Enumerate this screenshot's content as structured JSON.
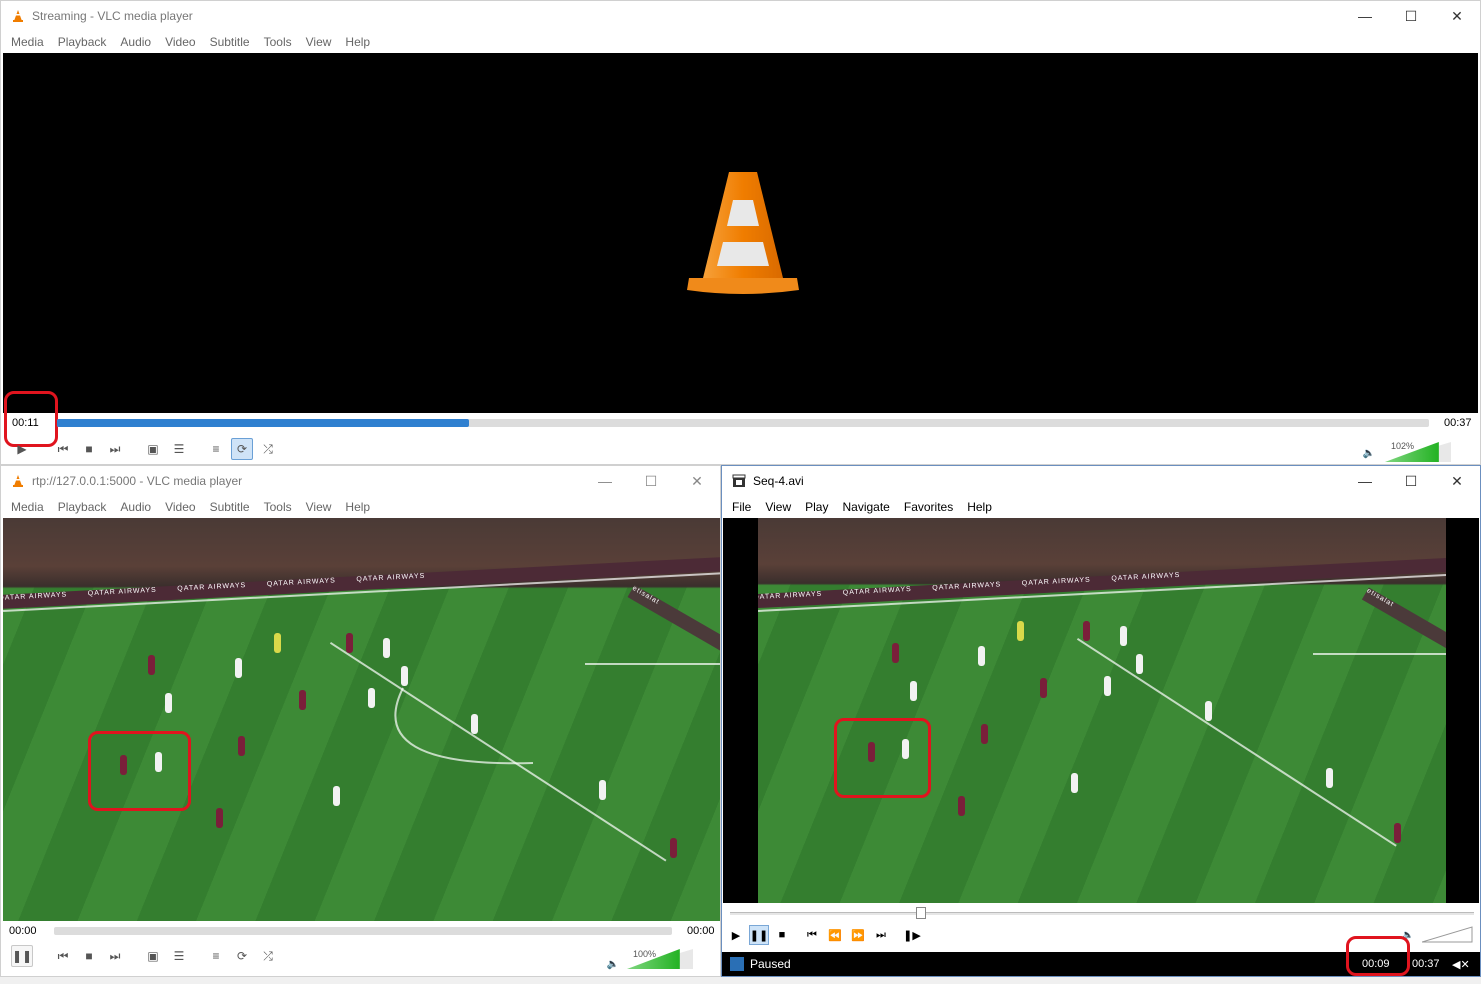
{
  "windows": {
    "streaming": {
      "title": "Streaming - VLC media player",
      "menus": [
        "Media",
        "Playback",
        "Audio",
        "Video",
        "Subtitle",
        "Tools",
        "View",
        "Help"
      ],
      "elapsed": "00:11",
      "total": "00:37",
      "progress": 0.3,
      "volume_label": "102%",
      "volume": 1.02
    },
    "rtp": {
      "title": "rtp://127.0.0.1:5000 - VLC media player",
      "menus": [
        "Media",
        "Playback",
        "Audio",
        "Video",
        "Subtitle",
        "Tools",
        "View",
        "Help"
      ],
      "elapsed": "00:00",
      "total": "00:00",
      "progress": 0,
      "volume_label": "100%",
      "volume": 1.0,
      "field_ads": [
        "QATAR AIRWAYS",
        "QATAR AIRWAYS",
        "QATAR AIRWAYS",
        "QATAR AIRWAYS",
        "QATAR AIRWAYS",
        "etisalat"
      ]
    },
    "mpc": {
      "title": "Seq-4.avi",
      "menus": [
        "File",
        "View",
        "Play",
        "Navigate",
        "Favorites",
        "Help"
      ],
      "status": "Paused",
      "elapsed": "00:09",
      "total": "00:37",
      "progress": 0.25,
      "field_ads": [
        "QATAR AIRWAYS",
        "QATAR AIRWAYS",
        "QATAR AIRWAYS",
        "QATAR AIRWAYS",
        "QATAR AIRWAYS",
        "etisalat"
      ]
    }
  },
  "icons": {
    "minimize": "minimize-icon",
    "maximize": "maximize-icon",
    "close": "close-icon",
    "vlc": "vlc-cone-icon"
  },
  "colors": {
    "seek_fill": "#2f80d0",
    "highlight": "#e0141e",
    "volume": "#23b223"
  }
}
